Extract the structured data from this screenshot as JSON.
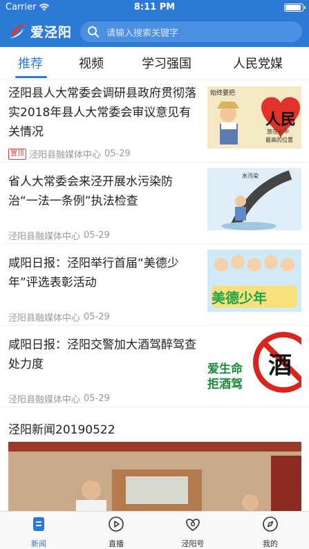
{
  "status_bar": {
    "carrier": "Carrier",
    "time": "8:11 PM"
  },
  "header": {
    "app_name": "爱泾阳",
    "search_placeholder": "请输入搜索关键字",
    "brand_color": "#2d7ad6"
  },
  "tabs": [
    {
      "label": "推荐",
      "active": true
    },
    {
      "label": "视频",
      "active": false
    },
    {
      "label": "学习强国",
      "active": false
    },
    {
      "label": "人民党媒",
      "active": false
    }
  ],
  "feed": [
    {
      "title": "泾阳县人大常委会调研县政府贯彻落实2018年县人大常委会审议意见有关情况",
      "tag": "置顶",
      "source": "泾阳县融媒体中心",
      "date": "05-29",
      "thumb": {
        "caption_top": "始终要把",
        "caption_char": "人民",
        "caption_line2": "放在心中",
        "caption_line3": "最高的位置"
      }
    },
    {
      "title": "省人大常委会来泾开展水污染防治“一法一条例”执法检查",
      "tag": "",
      "source": "泾阳县融媒体中心",
      "date": "05-29",
      "thumb": {
        "caption": "水污染"
      }
    },
    {
      "title": "咸阳日报：泾阳举行首届“美德少年”评选表彰活动",
      "tag": "",
      "source": "泾阳县融媒体中心",
      "date": "05-29",
      "thumb": {
        "caption": "美德少年"
      }
    },
    {
      "title": "咸阳日报：泾阳交警加大酒驾醉驾查处力度",
      "tag": "",
      "source": "泾阳县融媒体中心",
      "date": "05-29",
      "thumb": {
        "sign_char": "酒",
        "line1": "爱生命",
        "line2": "拒酒驾"
      }
    }
  ],
  "video_news": {
    "title": "泾阳新闻20190522"
  },
  "tab_bar": [
    {
      "label": "新闻",
      "icon": "news-icon",
      "active": true
    },
    {
      "label": "直播",
      "icon": "play-icon",
      "active": false
    },
    {
      "label": "泾阳号",
      "icon": "jingyang-icon",
      "active": false
    },
    {
      "label": "我的",
      "icon": "compass-icon",
      "active": false
    }
  ]
}
